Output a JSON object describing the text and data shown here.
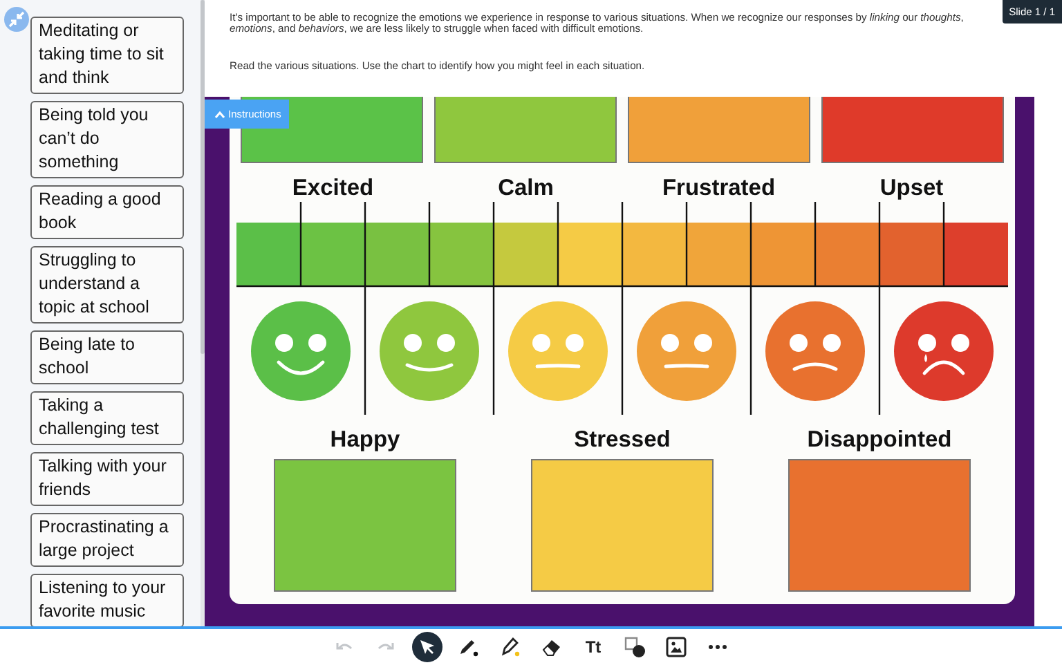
{
  "sidebar": {
    "cards": [
      "Meditating or taking time to sit and think",
      "Being told you can’t do something",
      "Reading a good book",
      "Struggling to understand a topic at school",
      "Being late to school",
      "Taking a challenging test",
      "Talking with your friends",
      "Procrastinating a large project",
      "Listening to your favorite music"
    ]
  },
  "header": {
    "paragraphs": [
      "It’s important to be able to recognize the emotions we experience in response to various situations. When we recognize our responses by *linking* our *thoughts*, *emotions*, and *behaviors*, we are less likely to struggle when faced with difficult emotions.",
      "Read the various situations. Use the chart to identify how you might feel in each situation."
    ],
    "slide_label": "Slide 1 / 1"
  },
  "instructions_tab": {
    "label": "Instructions"
  },
  "chart": {
    "top_blocks": [
      {
        "color": "#5bc248"
      },
      {
        "color": "#8fc73e"
      },
      {
        "color": "#f0a03a"
      },
      {
        "color": "#df3a2a"
      }
    ],
    "top_labels": [
      "Excited",
      "Calm",
      "Frustrated",
      "Upset"
    ],
    "scale": [
      {
        "color": "#5bbf48"
      },
      {
        "color": "#6cc244"
      },
      {
        "color": "#79c141"
      },
      {
        "color": "#86c43f"
      },
      {
        "color": "#c5c93e"
      },
      {
        "color": "#f5cb45"
      },
      {
        "color": "#f3b840"
      },
      {
        "color": "#f0a53a"
      },
      {
        "color": "#ee9535"
      },
      {
        "color": "#ea7f32"
      },
      {
        "color": "#e2622e"
      },
      {
        "color": "#dd3f2c"
      }
    ],
    "faces": [
      {
        "kind": "grin",
        "color": "#5bbf48"
      },
      {
        "kind": "smile",
        "color": "#8fc73e"
      },
      {
        "kind": "neutral",
        "color": "#f5cb45"
      },
      {
        "kind": "neutral",
        "color": "#f0a03a"
      },
      {
        "kind": "frown",
        "color": "#e8712f"
      },
      {
        "kind": "crying",
        "color": "#dd3a2c"
      }
    ],
    "bottom": [
      {
        "label": "Happy",
        "color": "#7bc441"
      },
      {
        "label": "Stressed",
        "color": "#f5cb45"
      },
      {
        "label": "Disappointed",
        "color": "#e8712f"
      }
    ]
  },
  "toolbar": {
    "tools": [
      {
        "kind": "undo",
        "disabled": true,
        "selected": false
      },
      {
        "kind": "redo",
        "disabled": true,
        "selected": false
      },
      {
        "kind": "select",
        "disabled": false,
        "selected": true
      },
      {
        "kind": "pen",
        "disabled": false,
        "selected": false
      },
      {
        "kind": "highlighter",
        "disabled": false,
        "selected": false
      },
      {
        "kind": "eraser",
        "disabled": false,
        "selected": false
      },
      {
        "kind": "text",
        "label": "Tt",
        "disabled": false,
        "selected": false
      },
      {
        "kind": "shape",
        "disabled": false,
        "selected": false
      },
      {
        "kind": "image",
        "disabled": false,
        "selected": false
      },
      {
        "kind": "more",
        "disabled": false,
        "selected": false
      }
    ]
  }
}
